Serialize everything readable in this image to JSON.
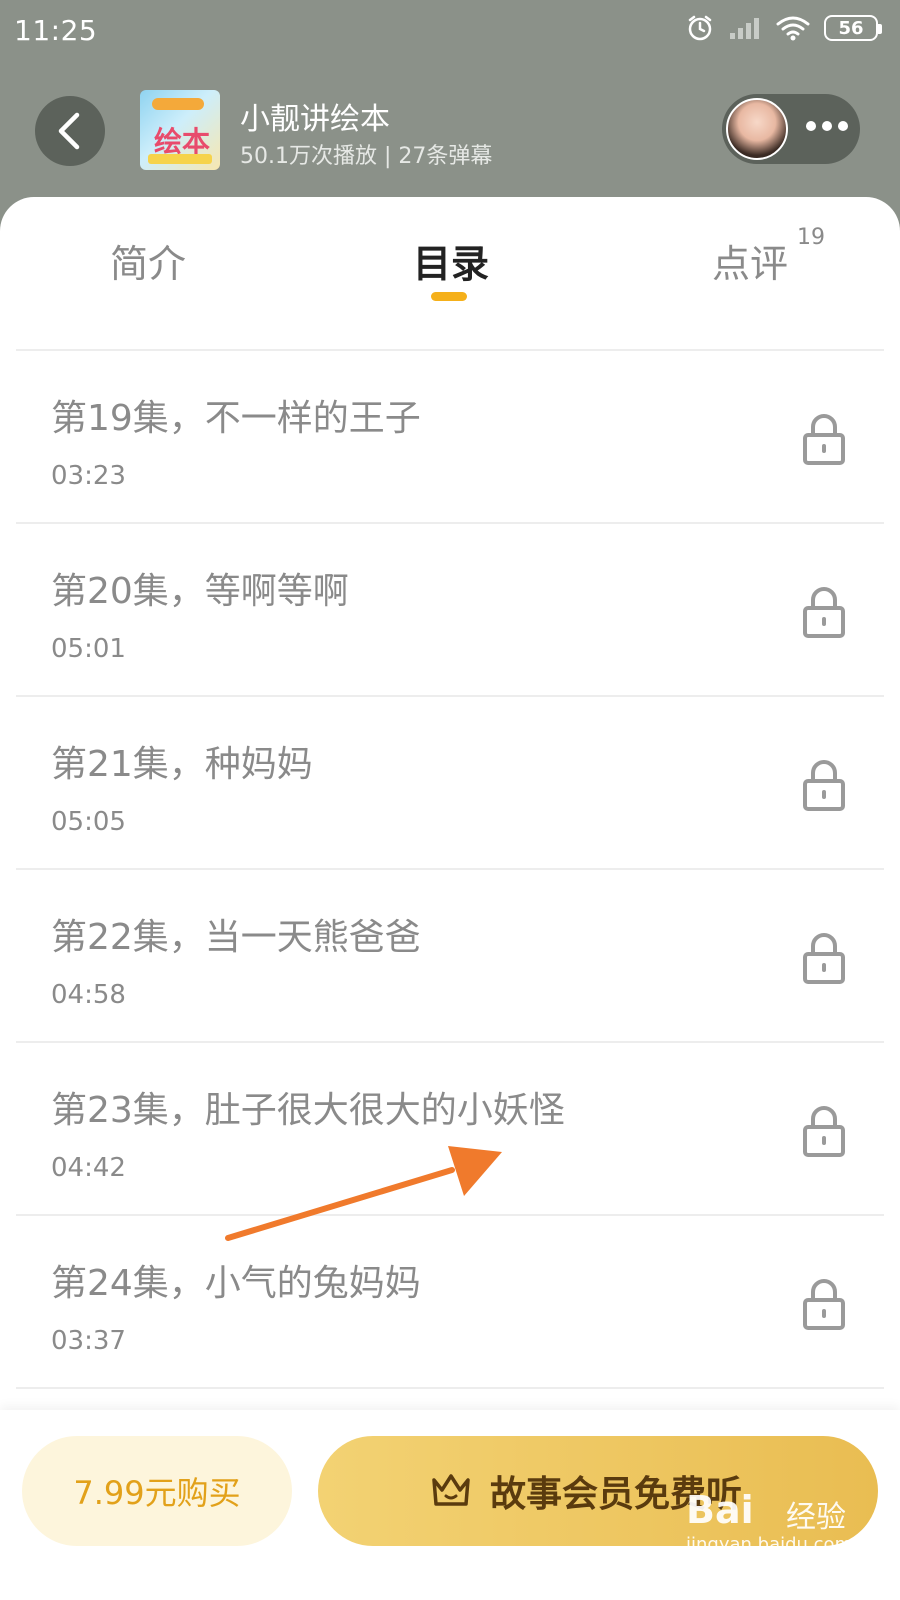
{
  "status_bar": {
    "time": "11:25",
    "battery": "56"
  },
  "header": {
    "album_title": "小靓讲绘本",
    "album_meta": "50.1万次播放 | 27条弹幕",
    "cover_text": "绘本"
  },
  "tabs": {
    "intro": "简介",
    "catalog": "目录",
    "review": "点评",
    "review_count": "19",
    "active": "目录"
  },
  "episodes": [
    {
      "title": "第19集，不一样的王子",
      "duration": "03:23",
      "locked": true
    },
    {
      "title": "第20集，等啊等啊",
      "duration": "05:01",
      "locked": true
    },
    {
      "title": "第21集，种妈妈",
      "duration": "05:05",
      "locked": true
    },
    {
      "title": "第22集，当一天熊爸爸",
      "duration": "04:58",
      "locked": true
    },
    {
      "title": "第23集，肚子很大很大的小妖怪",
      "duration": "04:42",
      "locked": true
    },
    {
      "title": "第24集，小气的兔妈妈",
      "duration": "03:37",
      "locked": true
    }
  ],
  "bottom_bar": {
    "buy_label": "7.99元购买",
    "vip_label": "故事会员免费听"
  },
  "watermark": {
    "brand": "Bai",
    "brand_cn": "经验",
    "url": "jingyan.baidu.com"
  },
  "colors": {
    "header_bg": "#8b9189",
    "accent": "#f5b01a",
    "vip_gold": "#e9bd52",
    "arrow": "#f07a2c"
  }
}
